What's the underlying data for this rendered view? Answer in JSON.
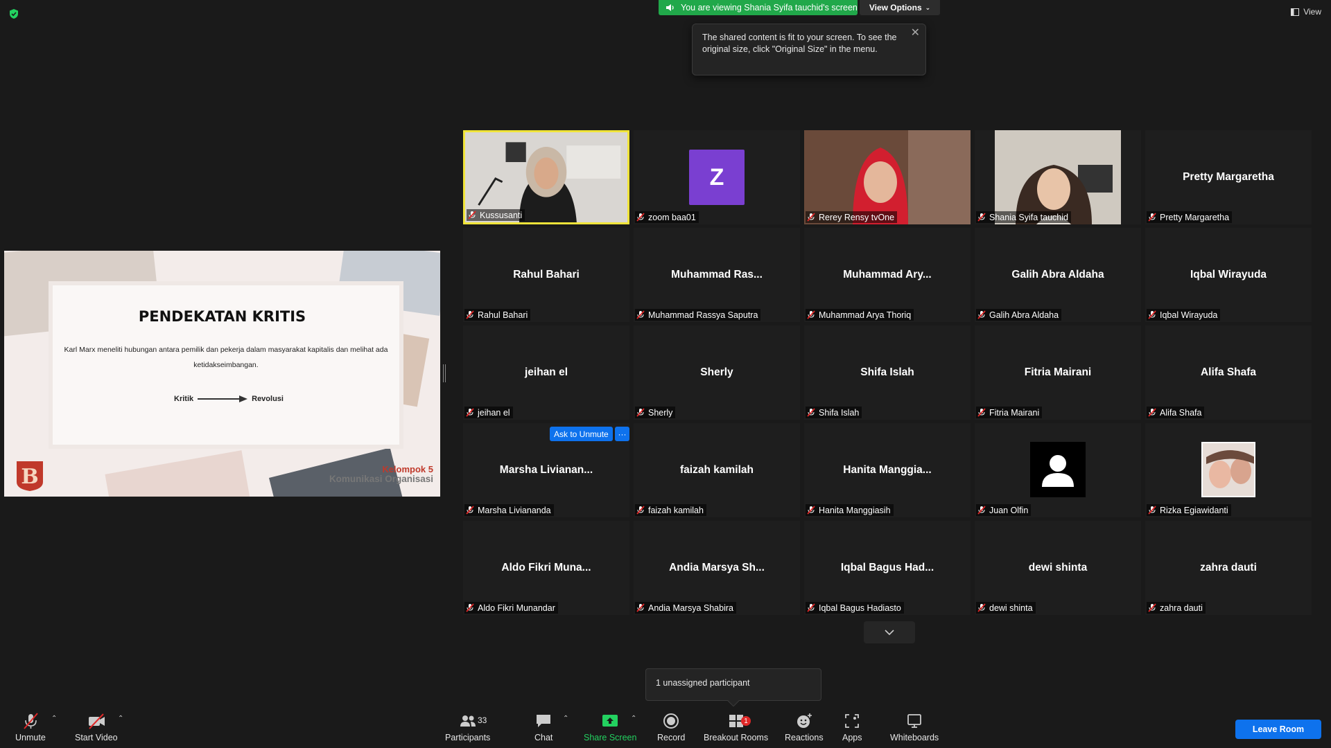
{
  "banner": {
    "viewing_text": "You are viewing Shania Syifa tauchid's screen",
    "view_options_label": "View Options",
    "view_label": "View"
  },
  "tooltip": {
    "text": "The shared content is fit to your screen. To see the original size, click \"Original Size\" in the menu."
  },
  "slide": {
    "title": "PENDEKATAN KRITIS",
    "body": "Karl Marx meneliti hubungan antara pemilik dan pekerja dalam masyarakat kapitalis dan melihat ada ketidakseimbangan.",
    "flow_from": "Kritik",
    "flow_to": "Revolusi",
    "group": "Kelompok 5",
    "course": "Komunikasi Organisasi"
  },
  "participants": [
    {
      "label": "Kussusanti",
      "kind": "video",
      "active": true
    },
    {
      "label": "zoom baa01",
      "kind": "letter",
      "letter": "Z"
    },
    {
      "label": "Rerey Rensy tvOne",
      "kind": "video2"
    },
    {
      "label": "Shania Syifa tauchid",
      "kind": "video3"
    },
    {
      "label": "Pretty Margaretha",
      "center": "Pretty Margaretha"
    },
    {
      "label": "Rahul Bahari",
      "center": "Rahul Bahari"
    },
    {
      "label": "Muhammad Rassya Saputra",
      "center": "Muhammad  Ras..."
    },
    {
      "label": "Muhammad Arya Thoriq",
      "center": "Muhammad  Ary..."
    },
    {
      "label": "Galih Abra Aldaha",
      "center": "Galih Abra Aldaha"
    },
    {
      "label": "Iqbal Wirayuda",
      "center": "Iqbal Wirayuda"
    },
    {
      "label": "jeihan el",
      "center": "jeihan el"
    },
    {
      "label": "Sherly",
      "center": "Sherly"
    },
    {
      "label": "Shifa Islah",
      "center": "Shifa Islah"
    },
    {
      "label": "Fitria Mairani",
      "center": "Fitria Mairani"
    },
    {
      "label": "Alifa Shafa",
      "center": "Alifa Shafa"
    },
    {
      "label": "Marsha Liviananda",
      "center": "Marsha  Livianan..."
    },
    {
      "label": "faizah kamilah",
      "center": "faizah kamilah"
    },
    {
      "label": "Hanita Manggiasih",
      "center": "Hanita  Manggia..."
    },
    {
      "label": "Juan Olfin",
      "kind": "default"
    },
    {
      "label": "Rizka Egiawidanti",
      "kind": "photo"
    },
    {
      "label": "Aldo Fikri Munandar",
      "center": "Aldo  Fikri  Muna..."
    },
    {
      "label": "Andia Marsya Shabira",
      "center": "Andia  Marsya  Sh..."
    },
    {
      "label": "Iqbal Bagus Hadiasto",
      "center": "Iqbal Bagus  Had..."
    },
    {
      "label": "dewi shinta",
      "center": "dewi shinta"
    },
    {
      "label": "zahra dauti",
      "center": "zahra dauti"
    }
  ],
  "ask_unmute_label": "Ask to Unmute",
  "more_label": "···",
  "unassigned_text": "1 unassigned participant",
  "toolbar": {
    "unmute": "Unmute",
    "start_video": "Start Video",
    "participants": "Participants",
    "participants_count": "33",
    "chat": "Chat",
    "share_screen": "Share Screen",
    "record": "Record",
    "breakout_rooms": "Breakout Rooms",
    "breakout_badge": "1",
    "reactions": "Reactions",
    "apps": "Apps",
    "whiteboards": "Whiteboards",
    "leave": "Leave Room"
  },
  "colors": {
    "accent": "#0e72ed",
    "share_green": "#23d160",
    "banner_green": "#21a84a",
    "active_speaker": "#f0e43a",
    "muted_red": "#e02828"
  }
}
